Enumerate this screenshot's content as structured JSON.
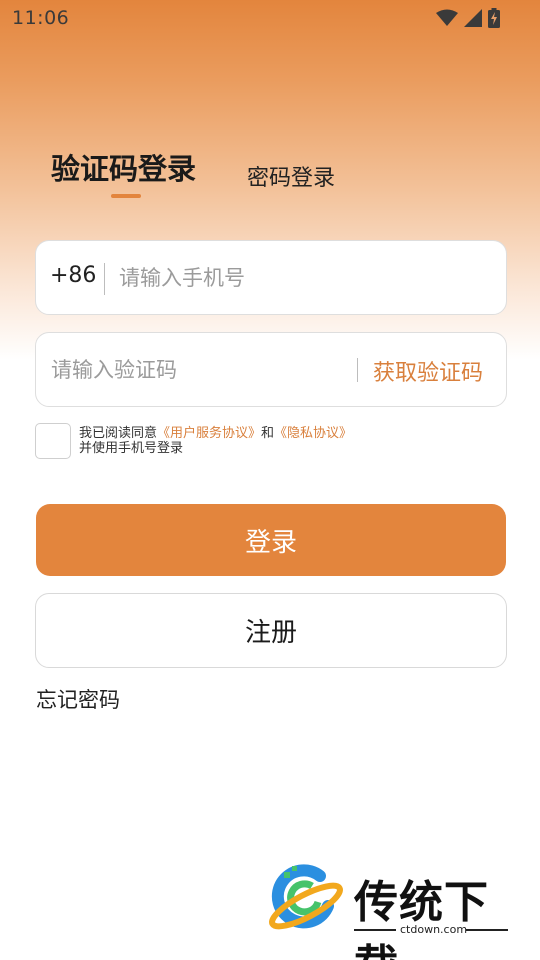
{
  "status_bar": {
    "time": "11:06",
    "icons": [
      "wifi-icon",
      "signal-icon",
      "battery-charging-icon"
    ]
  },
  "tabs": {
    "active": "验证码登录",
    "inactive": "密码登录"
  },
  "phone": {
    "prefix": "+86",
    "placeholder": "请输入手机号"
  },
  "code": {
    "placeholder": "请输入验证码",
    "get_code_label": "获取验证码"
  },
  "agreement": {
    "prefix": "我已阅读同意",
    "user_agreement": "《用户服务协议》",
    "and": "和",
    "privacy": "《隐私协议》",
    "suffix": "并使用手机号登录"
  },
  "buttons": {
    "login": "登录",
    "register": "注册",
    "forgot": "忘记密码"
  },
  "watermark": {
    "brand": "传统下载",
    "url": "ctdown.com"
  },
  "colors": {
    "accent": "#e3853d",
    "link": "#d9803d"
  }
}
